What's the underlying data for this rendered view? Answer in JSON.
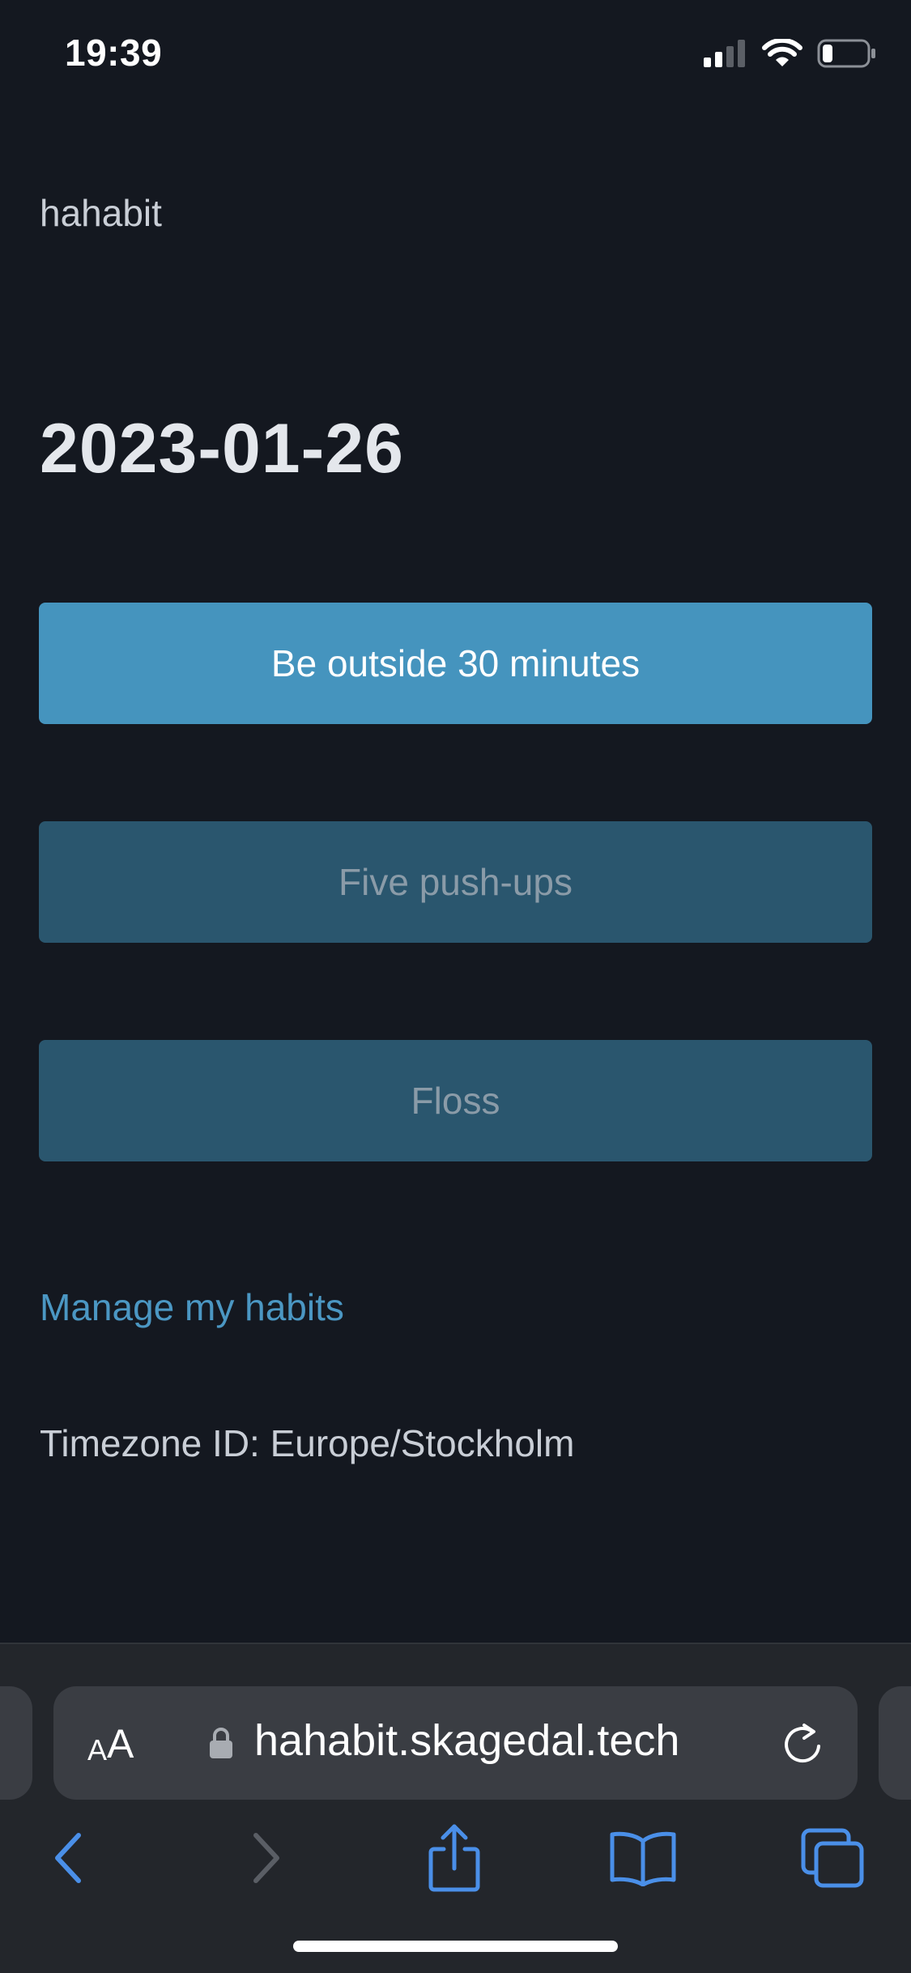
{
  "status_bar": {
    "time": "19:39"
  },
  "app": {
    "brand": "hahabit",
    "date": "2023-01-26",
    "habits": [
      {
        "label": "Be outside 30 minutes",
        "done": true
      },
      {
        "label": "Five push-ups",
        "done": false
      },
      {
        "label": "Floss",
        "done": false
      }
    ],
    "manage_link": "Manage my habits",
    "timezone": "Timezone ID: Europe/Stockholm"
  },
  "browser": {
    "text_size_label_small": "A",
    "text_size_label_large": "A",
    "url": "hahabit.skagedal.tech",
    "toolbar_icons": [
      "back-icon",
      "forward-icon",
      "share-icon",
      "bookmarks-icon",
      "tabs-icon"
    ]
  },
  "colors": {
    "background": "#141820",
    "habit_done": "#4594be",
    "habit_todo": "#2a566e",
    "link": "#4b97c3",
    "browser_accent": "#4a8fe8"
  }
}
